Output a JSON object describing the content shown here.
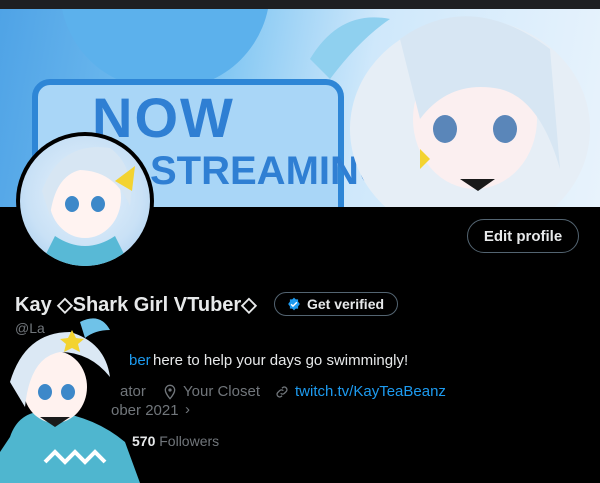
{
  "banner": {
    "line1": "NOW",
    "line2": "STREAMING"
  },
  "profile": {
    "display_name": "Kay ◇Shark Girl VTuber◇",
    "handle": "@La",
    "verified_label": "Get verified",
    "edit_label": "Edit profile",
    "bio_link": "ber",
    "bio_text": " here to help your days go swimmingly!",
    "category": "ator",
    "location": "Your Closet",
    "website": "twitch.tv/KayTeaBeanz",
    "joined": "ober 2021",
    "followers_count": "570",
    "followers_label": "Followers"
  },
  "colors": {
    "accent": "#1d9bf0",
    "text": "#e7e9ea",
    "muted": "#71767b",
    "border": "#536471"
  },
  "icons": [
    "verified-badge-icon",
    "location-pin-icon",
    "link-icon",
    "chevron-right-icon"
  ]
}
